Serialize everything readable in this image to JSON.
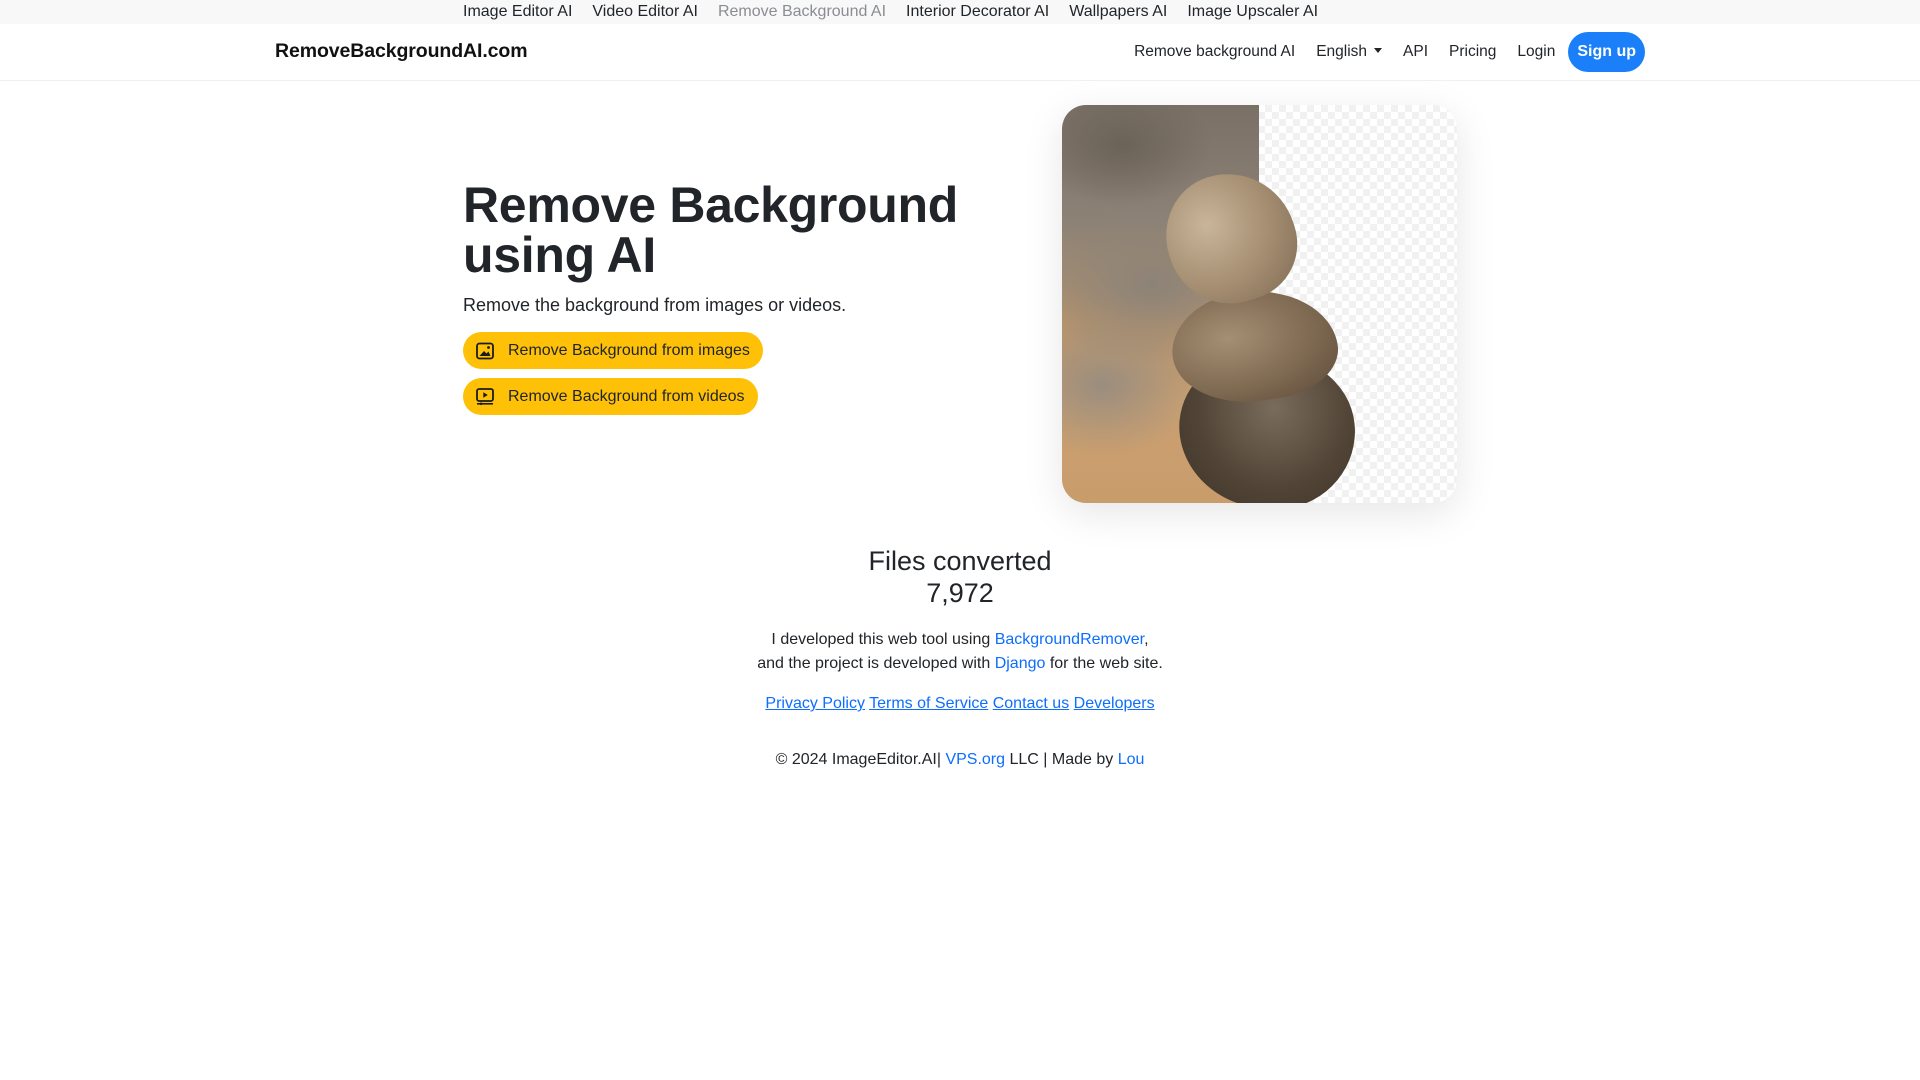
{
  "topbar": {
    "items": [
      {
        "label": "Image Editor AI",
        "active": false
      },
      {
        "label": "Video Editor AI",
        "active": false
      },
      {
        "label": "Remove Background AI",
        "active": true
      },
      {
        "label": "Interior Decorator AI",
        "active": false
      },
      {
        "label": "Wallpapers AI",
        "active": false
      },
      {
        "label": "Image Upscaler AI",
        "active": false
      }
    ]
  },
  "navbar": {
    "brand": "RemoveBackgroundAI.com",
    "links": {
      "remove_bg": "Remove background AI",
      "language": "English",
      "api": "API",
      "pricing": "Pricing",
      "login": "Login"
    },
    "signup_label": "Sign up"
  },
  "hero": {
    "title": "Remove Background using AI",
    "subtitle": "Remove the background from images or videos.",
    "buttons": [
      {
        "label": "Remove Background from images",
        "icon": "image-icon"
      },
      {
        "label": "Remove Background from videos",
        "icon": "video-icon"
      }
    ],
    "demo_image_alt": "Stacked rocks with background partially removed"
  },
  "stats": {
    "label": "Files converted",
    "value": "7,972"
  },
  "credits": {
    "line1_prefix": "I developed this web tool using ",
    "line1_link": "BackgroundRemover",
    "line1_suffix": ",",
    "line2_prefix": "and the project is developed with ",
    "line2_link": "Django",
    "line2_suffix": " for the web site."
  },
  "footer_links": [
    "Privacy Policy",
    "Terms of Service",
    "Contact us",
    "Developers"
  ],
  "copyright": {
    "prefix": "© 2024 ImageEditor.AI| ",
    "link1": "VPS.org",
    "middle": " LLC | Made by ",
    "link2": "Lou"
  },
  "colors": {
    "primary": "#0d6efd",
    "signup": "#1a7ff9",
    "warning": "#ffc107",
    "text": "#212529",
    "muted": "#8a8d91"
  }
}
